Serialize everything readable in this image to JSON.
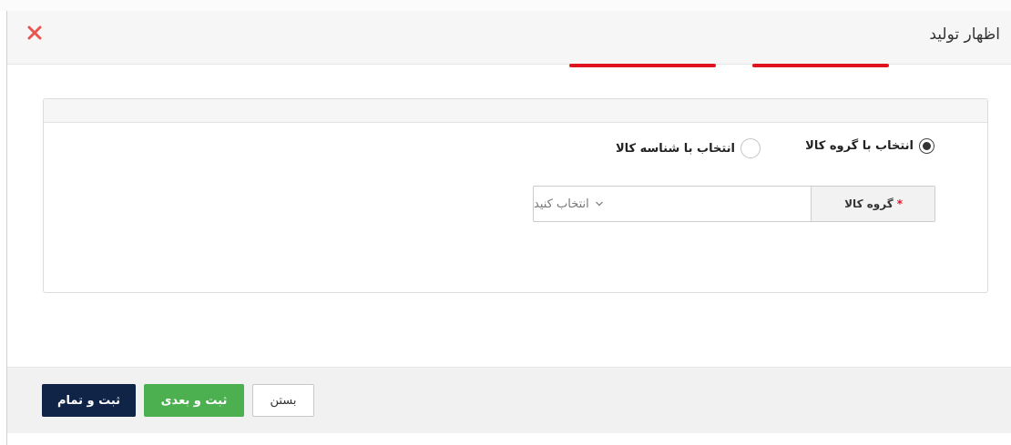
{
  "modal": {
    "title": "اظهار تولید"
  },
  "selection_mode": {
    "options": [
      {
        "label": "انتخاب با گروه کالا",
        "checked": true
      },
      {
        "label": "انتخاب با شناسه کالا",
        "checked": false
      }
    ]
  },
  "group_field": {
    "label": "گروه کالا",
    "required_mark": "*",
    "placeholder": "انتخاب کنید"
  },
  "footer": {
    "finish_label": "ثبت و تمام",
    "next_label": "ثبت و بعدی",
    "close_label": "بستن"
  },
  "colors": {
    "close_icon": "#e8554e",
    "underline": "#e0141f",
    "finish_button": "#102447",
    "next_button": "#4caf50"
  },
  "icons": {
    "close": "close-icon",
    "chevron": "chevron-down-icon"
  }
}
